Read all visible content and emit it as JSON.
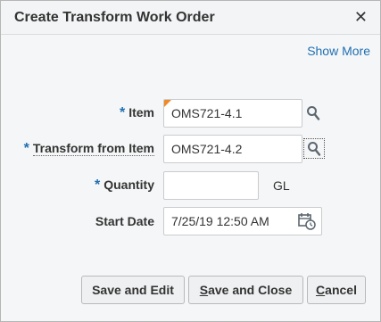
{
  "dialog": {
    "title": "Create Transform Work Order",
    "close_glyph": "✕",
    "show_more": "Show More"
  },
  "form": {
    "item": {
      "label": "Item",
      "required": "*",
      "value": "OMS721-4.1"
    },
    "transform_from": {
      "label": "Transform from Item",
      "required": "*",
      "value": "OMS721-4.2"
    },
    "quantity": {
      "label": "Quantity",
      "required": "*",
      "value": "",
      "uom": "GL"
    },
    "start_date": {
      "label": "Start Date",
      "value": "7/25/19 12:50 AM"
    }
  },
  "buttons": {
    "save_edit": "Save and Edit",
    "save_close_first": "S",
    "save_close_rest": "ave and Close",
    "cancel_first": "C",
    "cancel_rest": "ancel"
  },
  "colors": {
    "required_marker": "#1f6fb2",
    "link": "#1f6fb2",
    "changed_indicator": "#f08a24"
  }
}
